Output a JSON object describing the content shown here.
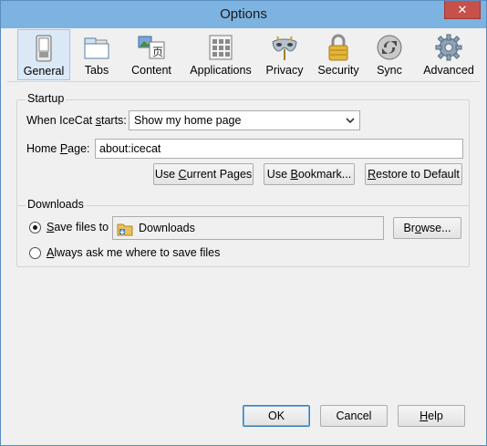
{
  "window": {
    "title": "Options",
    "close_glyph": "✕"
  },
  "toolbar": {
    "items": [
      {
        "label": "General",
        "icon": "general-switch-icon",
        "active": true
      },
      {
        "label": "Tabs",
        "icon": "tabs-icon",
        "active": false
      },
      {
        "label": "Content",
        "icon": "content-icon",
        "active": false
      },
      {
        "label": "Applications",
        "icon": "applications-icon",
        "active": false
      },
      {
        "label": "Privacy",
        "icon": "privacy-mask-icon",
        "active": false
      },
      {
        "label": "Security",
        "icon": "security-lock-icon",
        "active": false
      },
      {
        "label": "Sync",
        "icon": "sync-icon",
        "active": false
      },
      {
        "label": "Advanced",
        "icon": "advanced-gear-icon",
        "active": false
      }
    ]
  },
  "startup": {
    "group_label": "Startup",
    "when_starts_label_pre": "When IceCat ",
    "when_starts_label_u": "s",
    "when_starts_label_post": "tarts:",
    "when_starts_value": "Show my home page",
    "home_page_label_pre": "Home ",
    "home_page_label_u": "P",
    "home_page_label_post": "age:",
    "home_page_value": "about:icecat",
    "use_current_pre": "Use ",
    "use_current_u": "C",
    "use_current_post": "urrent Pages",
    "use_bookmark_pre": "Use ",
    "use_bookmark_u": "B",
    "use_bookmark_post": "ookmark...",
    "restore_pre": "",
    "restore_u": "R",
    "restore_post": "estore to Default"
  },
  "downloads": {
    "group_label": "Downloads",
    "save_files_pre": "",
    "save_files_u": "S",
    "save_files_post": "ave files to",
    "save_files_checked": true,
    "folder_value": "Downloads",
    "browse_pre": "Br",
    "browse_u": "o",
    "browse_post": "wse...",
    "always_ask_pre": "",
    "always_ask_u": "A",
    "always_ask_post": "lways ask me where to save files",
    "always_ask_checked": false
  },
  "footer": {
    "ok_label": "OK",
    "cancel_label": "Cancel",
    "help_pre": "",
    "help_u": "H",
    "help_post": "elp"
  },
  "colors": {
    "title_bar": "#7db3e0",
    "close_button": "#c7504a",
    "selected_tab": "#dbe9f7"
  }
}
